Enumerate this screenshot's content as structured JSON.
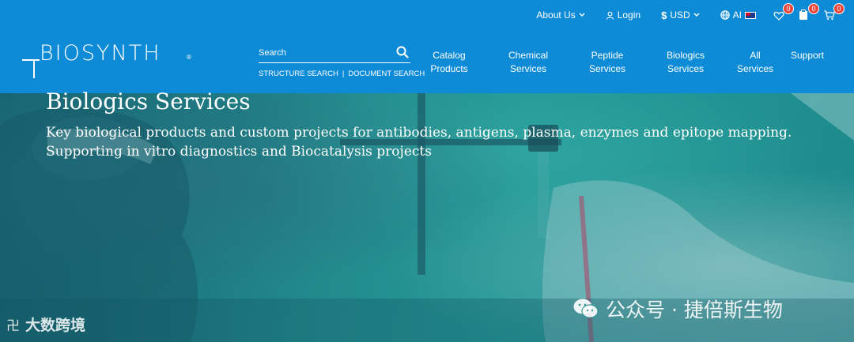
{
  "brand": {
    "name": "BIOSYNTH",
    "reg_mark": "®"
  },
  "utility_bar": {
    "about": "About Us",
    "login": "Login",
    "currency": "USD",
    "language": "AI",
    "wishlist_count": "0",
    "quote_count": "0",
    "cart_count": "0"
  },
  "search": {
    "placeholder": "Search",
    "structure_link": "STRUCTURE SEARCH",
    "separator": "|",
    "document_link": "DOCUMENT SEARCH"
  },
  "nav": {
    "items": [
      {
        "line1": "Catalog",
        "line2": "Products"
      },
      {
        "line1": "Chemical",
        "line2": "Services"
      },
      {
        "line1": "Peptide",
        "line2": "Services"
      },
      {
        "line1": "Biologics",
        "line2": "Services"
      },
      {
        "line1": "All",
        "line2": "Services"
      },
      {
        "line1": "Support",
        "line2": ""
      }
    ]
  },
  "hero": {
    "title": "Biologics Services",
    "subtitle_line1": "Key biological products and custom projects for antibodies, antigens, plasma, enzymes and epitope mapping.",
    "subtitle_line2": "Supporting in vitro diagnostics and Biocatalysis projects"
  },
  "watermarks": {
    "left_mark": "卍",
    "left_text": "大数跨境",
    "right_text": "公众号 · 捷倍斯生物"
  },
  "colors": {
    "header_bg": "#0d8bd6",
    "badge": "#e8443a",
    "hero_teal": "#27a6a0"
  },
  "icons": {
    "chevron": "chevron-down-icon",
    "user": "user-icon",
    "globe": "globe-icon",
    "heart": "heart-icon",
    "clipboard": "clipboard-icon",
    "cart": "cart-icon",
    "search": "search-icon",
    "wechat": "wechat-icon"
  }
}
